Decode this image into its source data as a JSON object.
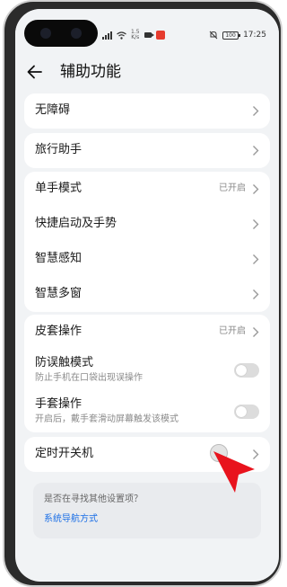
{
  "status_bar": {
    "network_speed": "1.5",
    "network_unit": "K/s",
    "battery_level": "100",
    "time": "17:25"
  },
  "header": {
    "title": "辅助功能"
  },
  "groups": [
    {
      "items": [
        {
          "label": "无障碍"
        }
      ]
    },
    {
      "items": [
        {
          "label": "旅行助手"
        }
      ]
    },
    {
      "items": [
        {
          "label": "单手模式",
          "status": "已开启"
        },
        {
          "label": "快捷启动及手势"
        },
        {
          "label": "智慧感知"
        },
        {
          "label": "智慧多窗"
        }
      ]
    },
    {
      "items": [
        {
          "label": "皮套操作",
          "status": "已开启"
        },
        {
          "label": "防误触模式",
          "sub": "防止手机在口袋出现误操作",
          "toggle": false
        },
        {
          "label": "手套操作",
          "sub": "开启后，戴手套滑动屏幕触发该模式",
          "toggle": false
        }
      ]
    },
    {
      "items": [
        {
          "label": "定时开关机"
        }
      ]
    }
  ],
  "suggestion": {
    "question": "是否在寻找其他设置项？",
    "link": "系统导航方式"
  },
  "colors": {
    "accent": "#1a6ee6",
    "pointer": "#e8131d",
    "background": "#f1f3f5"
  }
}
